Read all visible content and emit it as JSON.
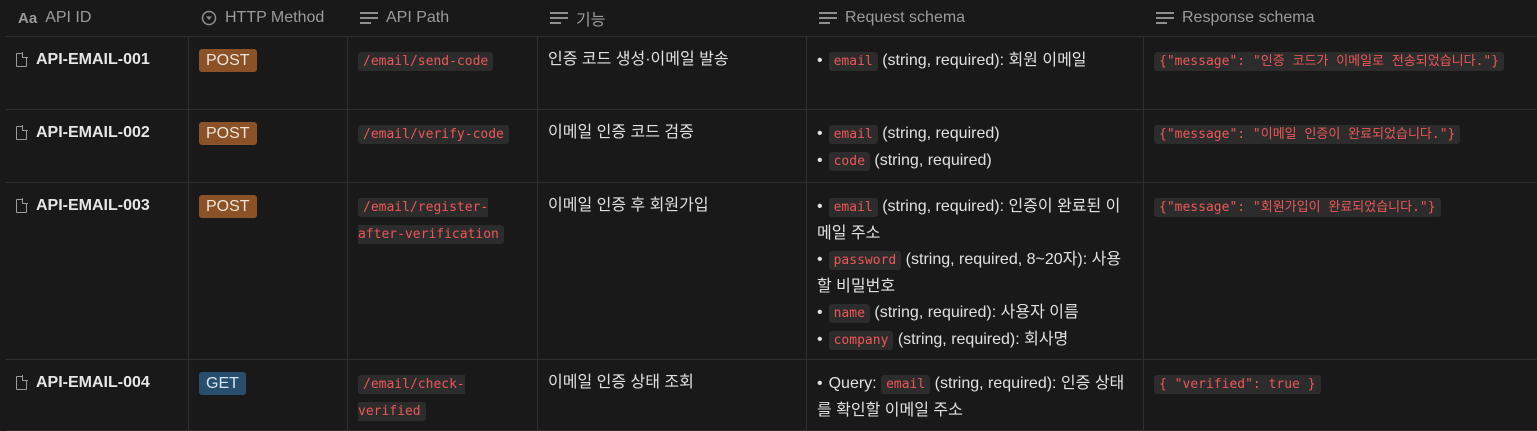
{
  "columns": [
    {
      "label": "API ID",
      "icon": "text-aa-icon"
    },
    {
      "label": "HTTP Method",
      "icon": "select-circle-icon"
    },
    {
      "label": "API Path",
      "icon": "text-lines-icon"
    },
    {
      "label": "기능",
      "icon": "text-lines-icon"
    },
    {
      "label": "Request schema",
      "icon": "text-lines-icon"
    },
    {
      "label": "Response schema",
      "icon": "text-lines-icon"
    }
  ],
  "rows": [
    {
      "id": "API-EMAIL-001",
      "method": "POST",
      "path": "/email/send-code",
      "func": "인증 코드 생성·이메일 발송",
      "request": [
        {
          "prefix": "",
          "code": "email",
          "text": " (string, required): 회원 이메일"
        }
      ],
      "response": "{\"message\": \"인증 코드가 이메일로 전송되었습니다.\"}"
    },
    {
      "id": "API-EMAIL-002",
      "method": "POST",
      "path": "/email/verify-code",
      "func": "이메일 인증 코드 검증",
      "request": [
        {
          "prefix": "",
          "code": "email",
          "text": " (string, required)"
        },
        {
          "prefix": "",
          "code": "code",
          "text": " (string, required)"
        }
      ],
      "response": "{\"message\": \"이메일 인증이 완료되었습니다.\"}"
    },
    {
      "id": "API-EMAIL-003",
      "method": "POST",
      "path": "/email/register-after-verification",
      "func": "이메일 인증 후 회원가입",
      "request": [
        {
          "prefix": "",
          "code": "email",
          "text": " (string, required): 인증이 완료된 이메일 주소"
        },
        {
          "prefix": "",
          "code": "password",
          "text": " (string, required, 8~20자): 사용할 비밀번호"
        },
        {
          "prefix": "",
          "code": "name",
          "text": " (string, required): 사용자 이름"
        },
        {
          "prefix": "",
          "code": "company",
          "text": " (string, required): 회사명"
        }
      ],
      "response": "{\"message\": \"회원가입이 완료되었습니다.\"}"
    },
    {
      "id": "API-EMAIL-004",
      "method": "GET",
      "path": "/email/check-verified",
      "func": "이메일 인증 상태 조회",
      "request": [
        {
          "prefix": "Query: ",
          "code": "email",
          "text": " (string, required): 인증 상태를 확인할 이메일 주소"
        }
      ],
      "response": "{ \"verified\": true }"
    }
  ]
}
